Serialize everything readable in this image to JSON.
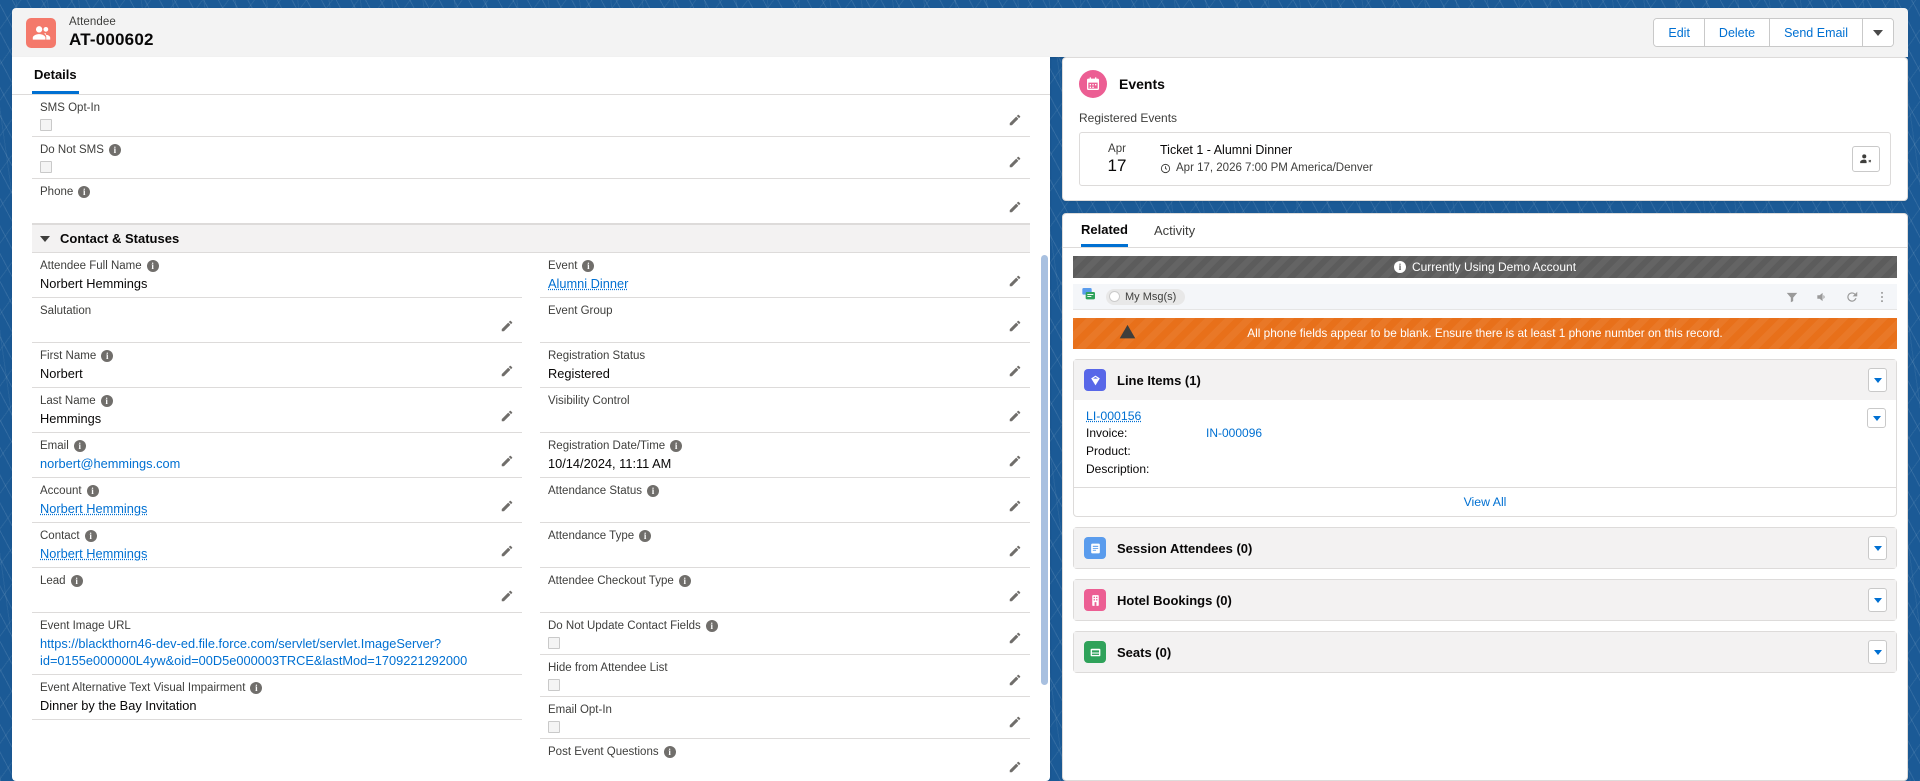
{
  "theme": {
    "background_blue": "#1b5a96",
    "link_blue": "#0070d2",
    "attendee_icon_color": "#f4796b",
    "events_icon_color": "#ec5e93",
    "warning_orange": "#e8701a",
    "demo_banner_gray": "#5c5c5c"
  },
  "header": {
    "object_label": "Attendee",
    "record_title": "AT-000602",
    "icon": "people-icon",
    "actions": {
      "edit": "Edit",
      "delete": "Delete",
      "send_email": "Send Email",
      "more": "chevron-down-icon"
    }
  },
  "details": {
    "tab_label": "Details",
    "top_fields": [
      {
        "label": "SMS Opt-In",
        "info": false,
        "type": "checkbox",
        "value": ""
      },
      {
        "label": "Do Not SMS",
        "info": true,
        "type": "checkbox",
        "value": ""
      },
      {
        "label": "Phone",
        "info": true,
        "type": "text",
        "value": ""
      }
    ],
    "section": {
      "title": "Contact & Statuses",
      "expanded": true
    },
    "left_fields": [
      {
        "label": "Attendee Full Name",
        "info": true,
        "type": "text",
        "value": "Norbert Hemmings",
        "editable": false
      },
      {
        "label": "Salutation",
        "info": false,
        "type": "text",
        "value": ""
      },
      {
        "label": "First Name",
        "info": true,
        "type": "text",
        "value": "Norbert"
      },
      {
        "label": "Last Name",
        "info": true,
        "type": "text",
        "value": "Hemmings"
      },
      {
        "label": "Email",
        "info": true,
        "type": "link",
        "value": "norbert@hemmings.com"
      },
      {
        "label": "Account",
        "info": true,
        "type": "dotted-link",
        "value": "Norbert Hemmings"
      },
      {
        "label": "Contact",
        "info": true,
        "type": "dotted-link",
        "value": "Norbert Hemmings"
      },
      {
        "label": "Lead",
        "info": true,
        "type": "text",
        "value": ""
      },
      {
        "label": "Event Image URL",
        "info": false,
        "type": "link",
        "value": "https://blackthorn46-dev-ed.file.force.com/servlet/servlet.ImageServer?id=0155e000000L4yw&oid=00D5e000003TRCE&lastMod=1709221292000",
        "editable": false
      },
      {
        "label": "Event Alternative Text Visual Impairment",
        "info": true,
        "type": "text",
        "value": "Dinner by the Bay Invitation",
        "editable": false
      }
    ],
    "right_fields": [
      {
        "label": "Event",
        "info": true,
        "type": "dotted-link",
        "value": "Alumni Dinner"
      },
      {
        "label": "Event Group",
        "info": false,
        "type": "text",
        "value": ""
      },
      {
        "label": "Registration Status",
        "info": false,
        "type": "text",
        "value": "Registered"
      },
      {
        "label": "Visibility Control",
        "info": false,
        "type": "text",
        "value": ""
      },
      {
        "label": "Registration Date/Time",
        "info": true,
        "type": "text",
        "value": "10/14/2024, 11:11 AM"
      },
      {
        "label": "Attendance Status",
        "info": true,
        "type": "text",
        "value": ""
      },
      {
        "label": "Attendance Type",
        "info": true,
        "type": "text",
        "value": ""
      },
      {
        "label": "Attendee Checkout Type",
        "info": true,
        "type": "text",
        "value": ""
      },
      {
        "label": "Do Not Update Contact Fields",
        "info": true,
        "type": "checkbox",
        "value": ""
      },
      {
        "label": "Hide from Attendee List",
        "info": false,
        "type": "checkbox",
        "value": ""
      },
      {
        "label": "Email Opt-In",
        "info": false,
        "type": "checkbox",
        "value": ""
      },
      {
        "label": "Post Event Questions",
        "info": true,
        "type": "text",
        "value": ""
      }
    ]
  },
  "events_panel": {
    "title": "Events",
    "icon": "calendar-icon",
    "subtitle": "Registered Events",
    "rows": [
      {
        "month": "Apr",
        "day": "17",
        "name": "Ticket 1 - Alumni Dinner",
        "datetime": "Apr 17, 2026 7:00 PM America/Denver",
        "action_icon": "remove-attendee-icon"
      }
    ]
  },
  "related_panel": {
    "tabs": [
      {
        "label": "Related",
        "active": true
      },
      {
        "label": "Activity",
        "active": false
      }
    ],
    "demo_banner": "Currently Using Demo Account",
    "messaging_toolbar": {
      "icon": "messages-icon",
      "pill_label": "My Msg(s)",
      "actions": [
        "filter-icon",
        "volume-icon",
        "refresh-icon",
        "overflow-menu-icon"
      ]
    },
    "warning": "All phone fields appear to be blank. Ensure there is at least 1 phone number on this record.",
    "blocks": [
      {
        "title": "Line Items (1)",
        "icon": "line-item-icon",
        "icon_color": "#5867e8",
        "expanded": true,
        "item": {
          "record": "LI-000156",
          "fields": [
            {
              "key": "Invoice:",
              "value": "IN-000096",
              "link": true
            },
            {
              "key": "Product:",
              "value": "",
              "link": false
            },
            {
              "key": "Description:",
              "value": "",
              "link": false
            }
          ]
        },
        "view_all": "View All"
      },
      {
        "title": "Session Attendees (0)",
        "icon": "session-icon",
        "icon_color": "#5a9ced",
        "expanded": false
      },
      {
        "title": "Hotel Bookings (0)",
        "icon": "hotel-icon",
        "icon_color": "#ec5e93",
        "expanded": false
      },
      {
        "title": "Seats (0)",
        "icon": "seat-icon",
        "icon_color": "#2fa25a",
        "expanded": false
      }
    ]
  }
}
